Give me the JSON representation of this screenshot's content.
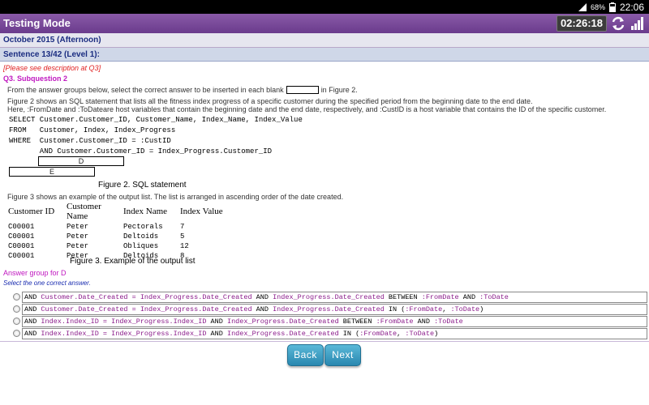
{
  "status_bar": {
    "battery": "68%",
    "time": "22:06"
  },
  "header": {
    "title": "Testing Mode",
    "timer": "02:26:18"
  },
  "exam": {
    "session": "October 2015 (Afternoon)"
  },
  "sentence": {
    "label": "Sentence 13/42 (Level 1):"
  },
  "question": {
    "note": "[Please see description at Q3]",
    "subquestion": "Q3. Subquestion 2",
    "intro_before": "From the answer groups below, select the correct answer to be inserted in each blank",
    "intro_after": "in Figure 2.",
    "fig2_desc": "Figure 2 shows an SQL statement that lists all the fitness index progress of a specific customer during the specified period from the beginning date to the end date.",
    "vars_desc": "Here, :FromDate and :ToDateare host variables that contain the beginning date and the end date, respectively, and :CustID is a host variable that contains the ID of the specific customer.",
    "sql": {
      "line1": "SELECT Customer.Customer_ID, Customer_Name, Index_Name, Index_Value",
      "line2": "FROM   Customer, Index, Index_Progress",
      "line3": "WHERE  Customer.Customer_ID = :CustID",
      "line4": "       AND Customer.Customer_ID = Index_Progress.Customer_ID",
      "blank_d": "D",
      "blank_e": "E"
    },
    "fig2_caption": "Figure 2.  SQL statement",
    "fig3_desc": "Figure 3 shows an example of the output list. The list is arranged in ascending order of the date created.",
    "table": {
      "headers": [
        "Customer ID",
        "Customer Name",
        "Index Name",
        "Index Value"
      ],
      "rows": [
        [
          "C00001",
          "Peter",
          "Pectorals",
          "7"
        ],
        [
          "C00001",
          "Peter",
          "Deltoids",
          "5"
        ],
        [
          "C00001",
          "Peter",
          "Obliques",
          "12"
        ],
        [
          "C00001",
          "Peter",
          "Deltoids",
          "8"
        ]
      ]
    },
    "fig3_caption": "Figure 3.  Example of the output list"
  },
  "answers": {
    "group_title": "Answer group for D",
    "instruction": "Select the one correct answer.",
    "options": [
      {
        "p1": "AND ",
        "p2": "Customer.Date_Created = Index_Progress.Date_Created",
        "p3": " AND ",
        "p4": "Index_Progress.Date_Created",
        "p5": " BETWEEN ",
        "p6": ":FromDate",
        "p7": " AND ",
        "p8": ":ToDate",
        "p9": ""
      },
      {
        "p1": "AND ",
        "p2": "Customer.Date_Created = Index_Progress.Date_Created",
        "p3": " AND ",
        "p4": "Index_Progress.Date_Created",
        "p5": " IN (",
        "p6": ":FromDate",
        "p7": ", ",
        "p8": ":ToDate",
        "p9": ")"
      },
      {
        "p1": "AND ",
        "p2": "Index.Index_ID = Index_Progress.Index_ID",
        "p3": " AND ",
        "p4": "Index_Progress.Date_Created",
        "p5": " BETWEEN ",
        "p6": ":FromDate",
        "p7": " AND ",
        "p8": ":ToDate",
        "p9": ""
      },
      {
        "p1": "AND ",
        "p2": "Index.Index_ID = Index_Progress.Index_ID",
        "p3": " AND ",
        "p4": "Index_Progress.Date_Created",
        "p5": " IN (",
        "p6": ":FromDate",
        "p7": ", ",
        "p8": ":ToDate",
        "p9": ")"
      }
    ]
  },
  "nav": {
    "back_label": "Back",
    "next_label": "Next"
  },
  "colors": {
    "header_purple": "#6a3b8c",
    "button_blue": "#2a88b0",
    "magenta": "#c018c0",
    "note_red": "#e02020"
  },
  "icons": [
    "signal-icon",
    "battery-icon",
    "refresh-icon",
    "signal-bars-icon"
  ]
}
